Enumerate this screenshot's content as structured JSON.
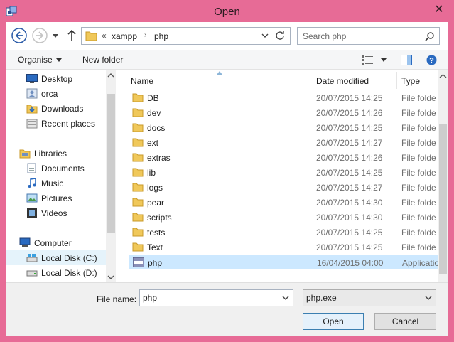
{
  "window": {
    "title": "Open",
    "close_glyph": "✕"
  },
  "address": {
    "overflow_chevron": "«",
    "crumbs": [
      "xampp",
      "php"
    ],
    "separator": "›"
  },
  "search": {
    "placeholder": "Search php"
  },
  "toolbar": {
    "organise_label": "Organise",
    "new_folder_label": "New folder"
  },
  "nav": {
    "items": [
      {
        "label": "Desktop",
        "icon": "desktop-icon"
      },
      {
        "label": "orca",
        "icon": "user-icon"
      },
      {
        "label": "Downloads",
        "icon": "downloads-icon"
      },
      {
        "label": "Recent places",
        "icon": "recent-places-icon"
      },
      {
        "label": "Libraries",
        "icon": "libraries-icon"
      },
      {
        "label": "Documents",
        "icon": "documents-icon"
      },
      {
        "label": "Music",
        "icon": "music-icon"
      },
      {
        "label": "Pictures",
        "icon": "pictures-icon"
      },
      {
        "label": "Videos",
        "icon": "videos-icon"
      },
      {
        "label": "Computer",
        "icon": "computer-icon"
      },
      {
        "label": "Local Disk (C:)",
        "icon": "drive-c-icon"
      },
      {
        "label": "Local Disk (D:)",
        "icon": "drive-icon"
      }
    ]
  },
  "columns": {
    "name": "Name",
    "date": "Date modified",
    "type": "Type"
  },
  "files": [
    {
      "name": "DB",
      "date": "20/07/2015 14:25",
      "type": "File folde"
    },
    {
      "name": "dev",
      "date": "20/07/2015 14:26",
      "type": "File folde"
    },
    {
      "name": "docs",
      "date": "20/07/2015 14:25",
      "type": "File folde"
    },
    {
      "name": "ext",
      "date": "20/07/2015 14:27",
      "type": "File folde"
    },
    {
      "name": "extras",
      "date": "20/07/2015 14:26",
      "type": "File folde"
    },
    {
      "name": "lib",
      "date": "20/07/2015 14:25",
      "type": "File folde"
    },
    {
      "name": "logs",
      "date": "20/07/2015 14:27",
      "type": "File folde"
    },
    {
      "name": "pear",
      "date": "20/07/2015 14:30",
      "type": "File folde"
    },
    {
      "name": "scripts",
      "date": "20/07/2015 14:30",
      "type": "File folde"
    },
    {
      "name": "tests",
      "date": "20/07/2015 14:25",
      "type": "File folde"
    },
    {
      "name": "Text",
      "date": "20/07/2015 14:25",
      "type": "File folde"
    },
    {
      "name": "php",
      "date": "16/04/2015 04:00",
      "type": "Applicatio"
    }
  ],
  "selected_file": "php",
  "bottom": {
    "file_name_label": "File name:",
    "file_name_value": "php",
    "file_type_value": "php.exe",
    "open_label": "Open",
    "cancel_label": "Cancel"
  },
  "colors": {
    "frame": "#e76b96",
    "selection": "#cce8ff",
    "selection_border": "#99d1ff",
    "folder": "#f0c85a"
  }
}
